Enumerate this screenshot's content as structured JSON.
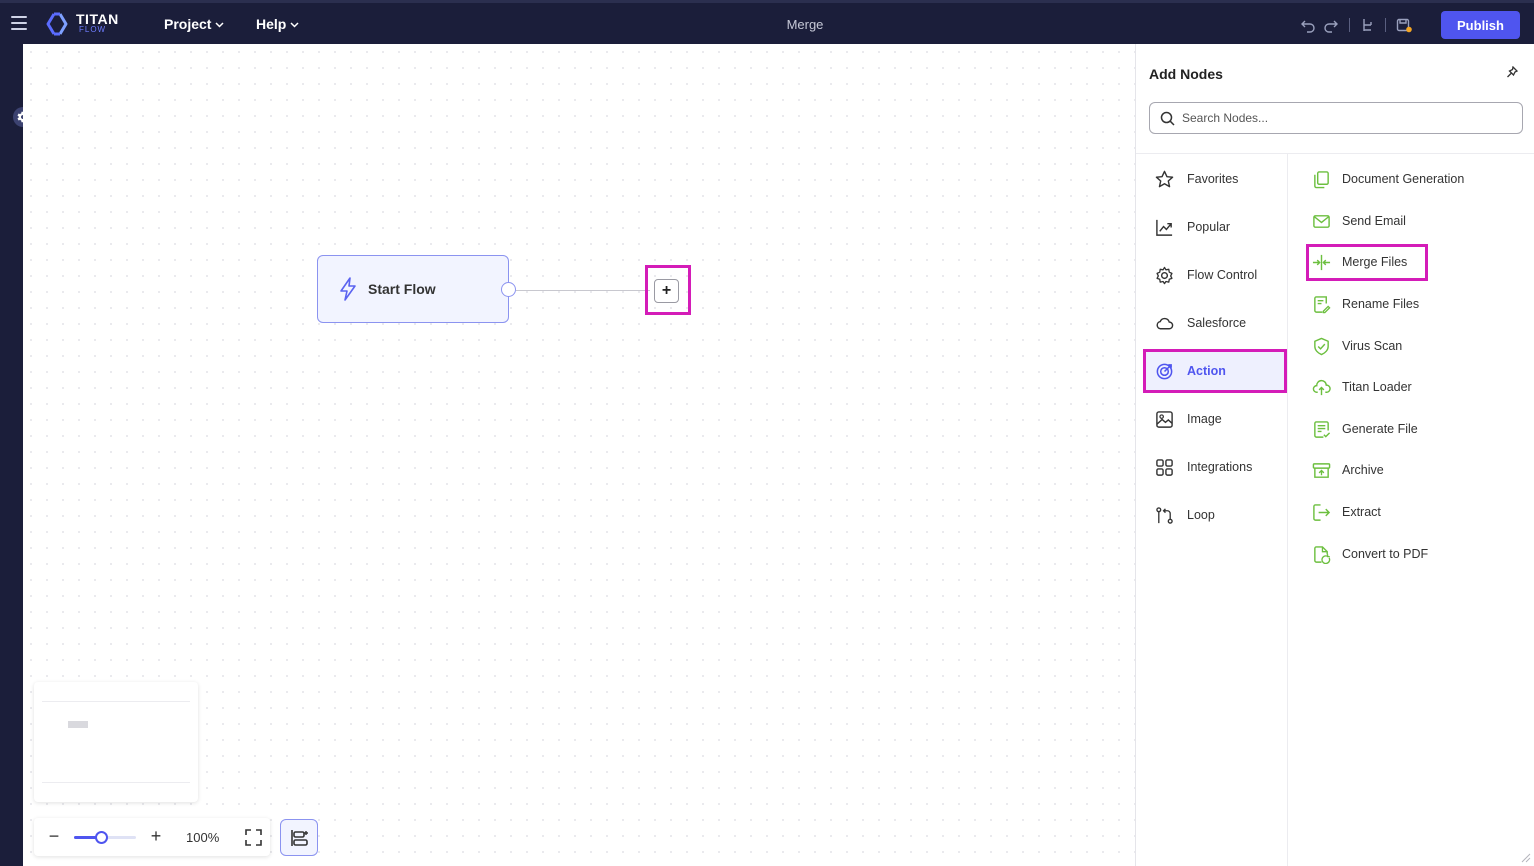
{
  "app": {
    "logo_text": "TITAN",
    "logo_sub": "FLOW",
    "doc_title": "Merge",
    "menus": [
      {
        "label": "Project"
      },
      {
        "label": "Help"
      }
    ],
    "publish_label": "Publish"
  },
  "canvas": {
    "start_node_label": "Start Flow",
    "add_button_label": "+",
    "zoom": {
      "value": 1.0,
      "label": "100%",
      "minus": "−",
      "plus": "+"
    }
  },
  "panel": {
    "title": "Add Nodes",
    "search": {
      "placeholder": "Search Nodes...",
      "value": ""
    },
    "categories": [
      {
        "label": "Favorites",
        "icon": "star-icon"
      },
      {
        "label": "Popular",
        "icon": "trend-icon"
      },
      {
        "label": "Flow Control",
        "icon": "gear-icon"
      },
      {
        "label": "Salesforce",
        "icon": "cloud-icon"
      },
      {
        "label": "Action",
        "icon": "target-icon",
        "active": true
      },
      {
        "label": "Image",
        "icon": "image-icon"
      },
      {
        "label": "Integrations",
        "icon": "grid-icon"
      },
      {
        "label": "Loop",
        "icon": "loop-icon"
      }
    ],
    "nodes": [
      {
        "label": "Document Generation",
        "icon": "documents-icon"
      },
      {
        "label": "Send Email",
        "icon": "email-icon"
      },
      {
        "label": "Merge Files",
        "icon": "merge-icon"
      },
      {
        "label": "Rename Files",
        "icon": "rename-file-icon"
      },
      {
        "label": "Virus Scan",
        "icon": "shield-check-icon"
      },
      {
        "label": "Titan Loader",
        "icon": "cloud-upload-icon"
      },
      {
        "label": "Generate File",
        "icon": "generate-file-icon"
      },
      {
        "label": "Archive",
        "icon": "archive-icon"
      },
      {
        "label": "Extract",
        "icon": "extract-icon"
      },
      {
        "label": "Convert to PDF",
        "icon": "convert-pdf-icon"
      }
    ]
  },
  "colors": {
    "topbar": "#1b1e3a",
    "accent": "#4f55ef",
    "node_icon_green": "#6cbf3f",
    "highlight": "#d41cb8"
  }
}
